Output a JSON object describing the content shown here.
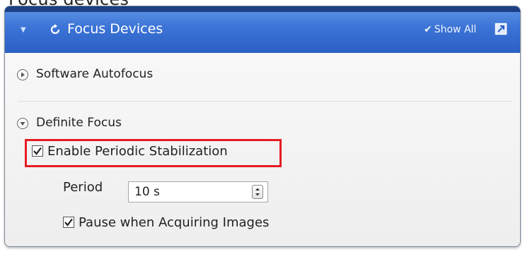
{
  "window": {
    "top_cut_text": "Focus devices"
  },
  "panel": {
    "title": "Focus Devices",
    "show_all_label": "Show All",
    "collapse_icon": "triangle-down-icon",
    "refresh_icon": "refresh-icon",
    "expand_icon": "expand-window-icon",
    "header_color": "#3c74d6"
  },
  "sections": [
    {
      "label": "Software Autofocus",
      "state": "collapsed"
    },
    {
      "label": "Definite Focus",
      "state": "expanded"
    }
  ],
  "definite_focus": {
    "enable_periodic_stabilization": {
      "label": "Enable Periodic Stabilization",
      "checked": true
    },
    "period": {
      "label": "Period",
      "value": "10 s"
    },
    "pause_when_acquiring": {
      "label": "Pause when Acquiring Images",
      "checked": true
    }
  },
  "highlight_color": "#e51c23"
}
